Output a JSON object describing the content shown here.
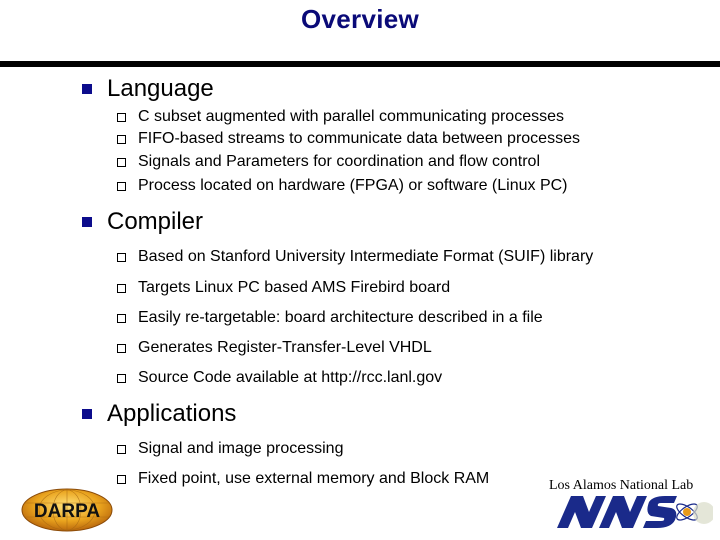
{
  "slide": {
    "title": "Overview",
    "sections": [
      {
        "heading": "Language",
        "items": [
          "C subset augmented with parallel communicating processes",
          "FIFO-based streams to communicate data between processes",
          "Signals and Parameters for coordination and flow control",
          "Process located on hardware (FPGA) or software (Linux PC)"
        ]
      },
      {
        "heading": "Compiler",
        "items": [
          "Based on Stanford University Intermediate Format (SUIF) library",
          "Targets Linux PC based AMS Firebird board",
          "Easily re-targetable: board architecture described in a file",
          "Generates Register-Transfer-Level VHDL",
          "Source Code available at http://rcc.lanl.gov"
        ]
      },
      {
        "heading": "Applications",
        "items": [
          "Signal and image processing",
          "Fixed point, use external memory and Block RAM"
        ]
      }
    ]
  },
  "logos": {
    "darpa": {
      "label": "DARPA",
      "icon": "darpa-logo"
    },
    "lanl_caption": "Los Alamos National Lab",
    "nnsa": {
      "label": "NNSA",
      "icon": "nnsa-logo"
    }
  },
  "colors": {
    "title": "#0a0a78",
    "bullet": "#0c0c8c",
    "darpa_gold": "#e8a41c",
    "nnsa_blue": "#1a2a8a"
  }
}
